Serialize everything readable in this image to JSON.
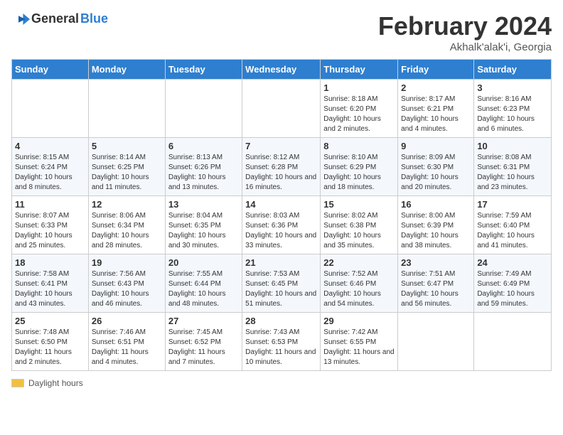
{
  "header": {
    "logo": {
      "text_general": "General",
      "text_blue": "Blue"
    },
    "month_year": "February 2024",
    "location": "Akhalk'alak'i, Georgia"
  },
  "days_of_week": [
    "Sunday",
    "Monday",
    "Tuesday",
    "Wednesday",
    "Thursday",
    "Friday",
    "Saturday"
  ],
  "weeks": [
    [
      {
        "day": "",
        "info": ""
      },
      {
        "day": "",
        "info": ""
      },
      {
        "day": "",
        "info": ""
      },
      {
        "day": "",
        "info": ""
      },
      {
        "day": "1",
        "info": "Sunrise: 8:18 AM\nSunset: 6:20 PM\nDaylight: 10 hours and 2 minutes."
      },
      {
        "day": "2",
        "info": "Sunrise: 8:17 AM\nSunset: 6:21 PM\nDaylight: 10 hours and 4 minutes."
      },
      {
        "day": "3",
        "info": "Sunrise: 8:16 AM\nSunset: 6:23 PM\nDaylight: 10 hours and 6 minutes."
      }
    ],
    [
      {
        "day": "4",
        "info": "Sunrise: 8:15 AM\nSunset: 6:24 PM\nDaylight: 10 hours and 8 minutes."
      },
      {
        "day": "5",
        "info": "Sunrise: 8:14 AM\nSunset: 6:25 PM\nDaylight: 10 hours and 11 minutes."
      },
      {
        "day": "6",
        "info": "Sunrise: 8:13 AM\nSunset: 6:26 PM\nDaylight: 10 hours and 13 minutes."
      },
      {
        "day": "7",
        "info": "Sunrise: 8:12 AM\nSunset: 6:28 PM\nDaylight: 10 hours and 16 minutes."
      },
      {
        "day": "8",
        "info": "Sunrise: 8:10 AM\nSunset: 6:29 PM\nDaylight: 10 hours and 18 minutes."
      },
      {
        "day": "9",
        "info": "Sunrise: 8:09 AM\nSunset: 6:30 PM\nDaylight: 10 hours and 20 minutes."
      },
      {
        "day": "10",
        "info": "Sunrise: 8:08 AM\nSunset: 6:31 PM\nDaylight: 10 hours and 23 minutes."
      }
    ],
    [
      {
        "day": "11",
        "info": "Sunrise: 8:07 AM\nSunset: 6:33 PM\nDaylight: 10 hours and 25 minutes."
      },
      {
        "day": "12",
        "info": "Sunrise: 8:06 AM\nSunset: 6:34 PM\nDaylight: 10 hours and 28 minutes."
      },
      {
        "day": "13",
        "info": "Sunrise: 8:04 AM\nSunset: 6:35 PM\nDaylight: 10 hours and 30 minutes."
      },
      {
        "day": "14",
        "info": "Sunrise: 8:03 AM\nSunset: 6:36 PM\nDaylight: 10 hours and 33 minutes."
      },
      {
        "day": "15",
        "info": "Sunrise: 8:02 AM\nSunset: 6:38 PM\nDaylight: 10 hours and 35 minutes."
      },
      {
        "day": "16",
        "info": "Sunrise: 8:00 AM\nSunset: 6:39 PM\nDaylight: 10 hours and 38 minutes."
      },
      {
        "day": "17",
        "info": "Sunrise: 7:59 AM\nSunset: 6:40 PM\nDaylight: 10 hours and 41 minutes."
      }
    ],
    [
      {
        "day": "18",
        "info": "Sunrise: 7:58 AM\nSunset: 6:41 PM\nDaylight: 10 hours and 43 minutes."
      },
      {
        "day": "19",
        "info": "Sunrise: 7:56 AM\nSunset: 6:43 PM\nDaylight: 10 hours and 46 minutes."
      },
      {
        "day": "20",
        "info": "Sunrise: 7:55 AM\nSunset: 6:44 PM\nDaylight: 10 hours and 48 minutes."
      },
      {
        "day": "21",
        "info": "Sunrise: 7:53 AM\nSunset: 6:45 PM\nDaylight: 10 hours and 51 minutes."
      },
      {
        "day": "22",
        "info": "Sunrise: 7:52 AM\nSunset: 6:46 PM\nDaylight: 10 hours and 54 minutes."
      },
      {
        "day": "23",
        "info": "Sunrise: 7:51 AM\nSunset: 6:47 PM\nDaylight: 10 hours and 56 minutes."
      },
      {
        "day": "24",
        "info": "Sunrise: 7:49 AM\nSunset: 6:49 PM\nDaylight: 10 hours and 59 minutes."
      }
    ],
    [
      {
        "day": "25",
        "info": "Sunrise: 7:48 AM\nSunset: 6:50 PM\nDaylight: 11 hours and 2 minutes."
      },
      {
        "day": "26",
        "info": "Sunrise: 7:46 AM\nSunset: 6:51 PM\nDaylight: 11 hours and 4 minutes."
      },
      {
        "day": "27",
        "info": "Sunrise: 7:45 AM\nSunset: 6:52 PM\nDaylight: 11 hours and 7 minutes."
      },
      {
        "day": "28",
        "info": "Sunrise: 7:43 AM\nSunset: 6:53 PM\nDaylight: 11 hours and 10 minutes."
      },
      {
        "day": "29",
        "info": "Sunrise: 7:42 AM\nSunset: 6:55 PM\nDaylight: 11 hours and 13 minutes."
      },
      {
        "day": "",
        "info": ""
      },
      {
        "day": "",
        "info": ""
      }
    ]
  ],
  "footer": {
    "label": "Daylight hours"
  }
}
